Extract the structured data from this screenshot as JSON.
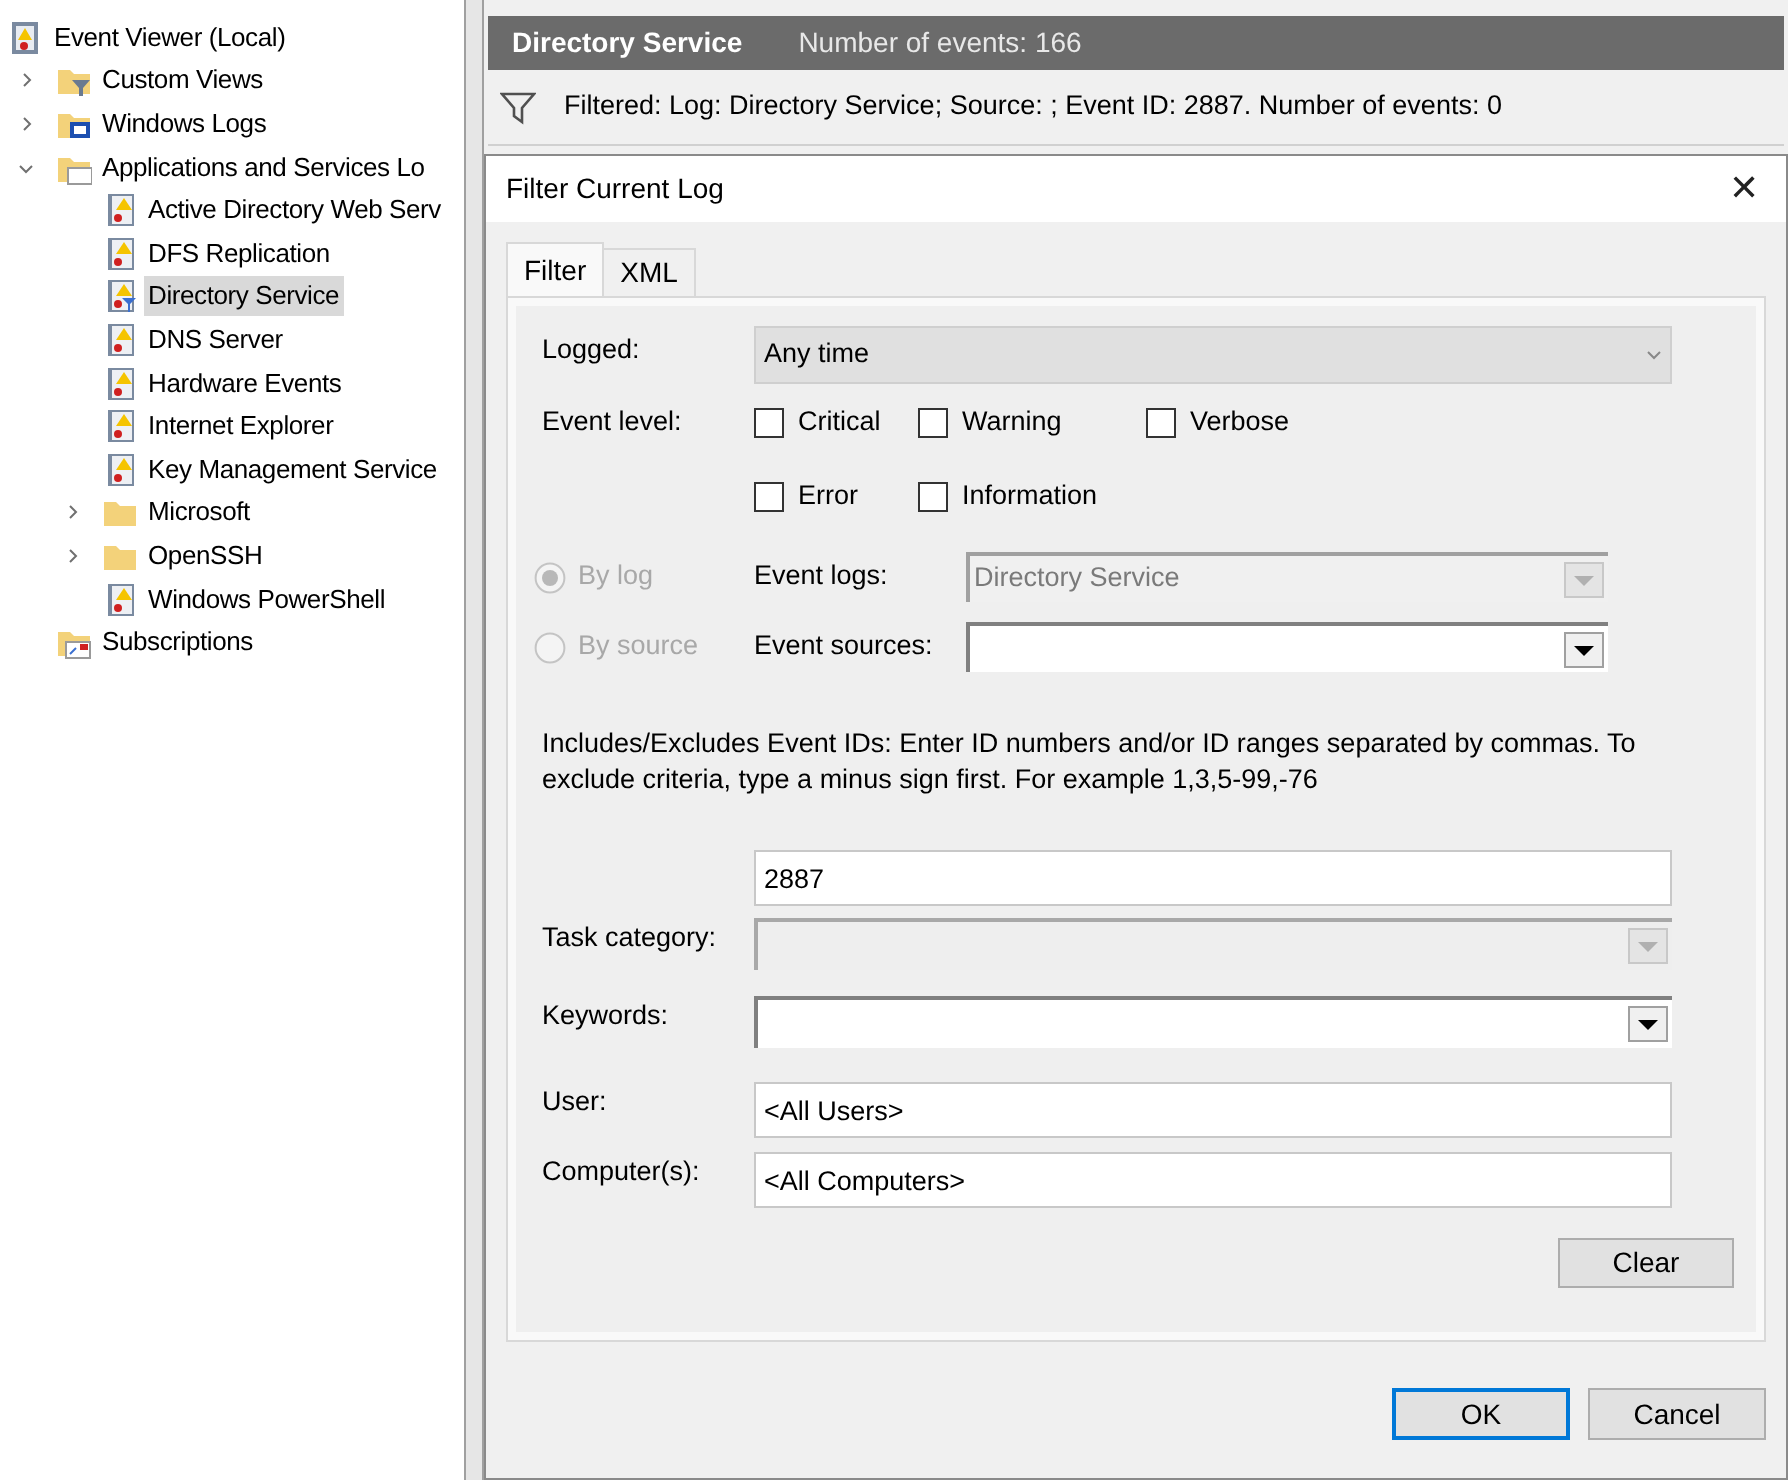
{
  "tree": {
    "label": "Event Viewer (Local)",
    "kind": "root",
    "children": [
      {
        "label": "Custom Views",
        "kind": "filter-folder",
        "expanded": false
      },
      {
        "label": "Windows Logs",
        "kind": "logs-folder",
        "expanded": false
      },
      {
        "label": "Applications and Services Lo",
        "kind": "folder-open",
        "expanded": true,
        "children": [
          {
            "label": "Active Directory Web Serv",
            "kind": "log",
            "selected": false
          },
          {
            "label": "DFS Replication",
            "kind": "log",
            "selected": false
          },
          {
            "label": "Directory Service",
            "kind": "log-filtered",
            "selected": true
          },
          {
            "label": "DNS Server",
            "kind": "log",
            "selected": false
          },
          {
            "label": "Hardware Events",
            "kind": "log",
            "selected": false
          },
          {
            "label": "Internet Explorer",
            "kind": "log",
            "selected": false
          },
          {
            "label": "Key Management Service",
            "kind": "log",
            "selected": false
          },
          {
            "label": "Microsoft",
            "kind": "folder",
            "expanded": false
          },
          {
            "label": "OpenSSH",
            "kind": "folder",
            "expanded": false
          },
          {
            "label": "Windows PowerShell",
            "kind": "log",
            "selected": false
          }
        ]
      },
      {
        "label": "Subscriptions",
        "kind": "subscriptions"
      }
    ]
  },
  "header": {
    "title": "Directory Service",
    "count": "Number of events: 166"
  },
  "filter_bar": {
    "text": "Filtered: Log: Directory Service; Source: ; Event ID: 2887. Number of events: 0"
  },
  "dialog": {
    "title": "Filter Current Log",
    "close": "✕",
    "tabs": [
      {
        "label": "Filter",
        "selected": true
      },
      {
        "label": "XML",
        "selected": false
      }
    ],
    "logged": {
      "label": "Logged:",
      "value": "Any time"
    },
    "event_level": {
      "label": "Event level:",
      "options": [
        {
          "label": "Critical",
          "checked": false
        },
        {
          "label": "Warning",
          "checked": false
        },
        {
          "label": "Verbose",
          "checked": false
        },
        {
          "label": "Error",
          "checked": false
        },
        {
          "label": "Information",
          "checked": false
        }
      ]
    },
    "sources": [
      {
        "radio": "By log",
        "selected": true,
        "label": "Event logs:",
        "value": "Directory Service",
        "disabled": true
      },
      {
        "radio": "By source",
        "selected": false,
        "label": "Event sources:",
        "disabled": false
      }
    ],
    "ids_hint": "Includes/Excludes Event IDs: Enter ID numbers and/or ID ranges separated by commas. To exclude criteria, type a minus sign first. For example 1,3,5-99,-76",
    "event_ids": {
      "value": "2887"
    },
    "task_category": {
      "label": "Task category:",
      "disabled": true
    },
    "keywords": {
      "label": "Keywords:",
      "disabled": false
    },
    "user": {
      "label": "User:",
      "value": "<All Users>"
    },
    "computers": {
      "label": "Computer(s):",
      "value": "<All Computers>"
    },
    "clear": "Clear",
    "buttons": [
      {
        "label": "OK",
        "default": true
      },
      {
        "label": "Cancel",
        "default": false
      }
    ]
  }
}
